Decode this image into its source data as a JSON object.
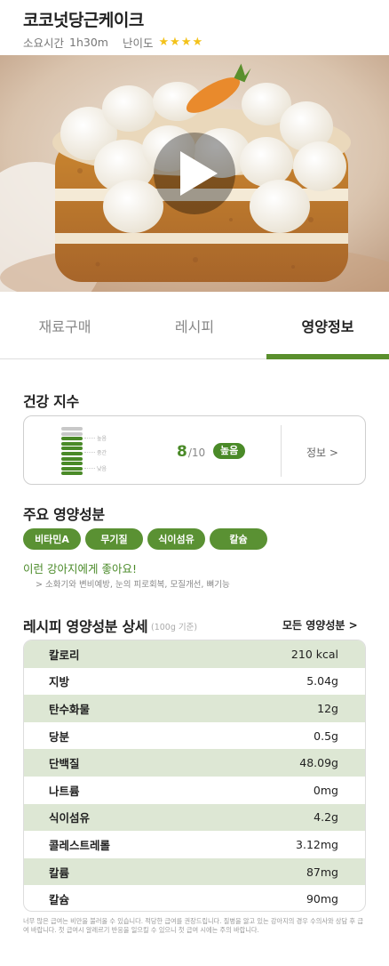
{
  "recipe": {
    "title": "코코넛당근케이크",
    "time_label": "소요시간",
    "time_value": "1h30m",
    "difficulty_label": "난이도",
    "difficulty_stars": 4,
    "star_color": "#f3c21a"
  },
  "video": {
    "play_icon": "play-icon"
  },
  "tabs": [
    {
      "label": "재료구매"
    },
    {
      "label": "레시피"
    },
    {
      "label": "영양정보"
    }
  ],
  "active_tab": 2,
  "accent_color": "#4a8a28",
  "health": {
    "title": "건강 지수",
    "gauge_levels": [
      "높음",
      "중간",
      "낮음"
    ],
    "score": "8",
    "score_max": "/10",
    "score_value": 0.8,
    "level": "높음",
    "info_link": "정보  >"
  },
  "main_nutrients": {
    "title": "주요 영양성분",
    "pills": [
      "비타민A",
      "무기질",
      "식이섬유",
      "칼슘"
    ],
    "good_for_title": "이런 강아지에게 좋아요!",
    "good_for_detail": ">   소화기와 변비예방, 눈의 피로회복, 모질개선, 뼈기능"
  },
  "detail": {
    "title": "레시피 영양성분 상세",
    "subtitle": "(100g 기준)",
    "all_link": "모든 영양성분 >",
    "rows": [
      {
        "name": "칼로리",
        "value": "210 kcal"
      },
      {
        "name": "지방",
        "value": "5.04g"
      },
      {
        "name": "탄수화물",
        "value": "12g"
      },
      {
        "name": "당분",
        "value": "0.5g"
      },
      {
        "name": "단백질",
        "value": "48.09g"
      },
      {
        "name": "나트륨",
        "value": "0mg"
      },
      {
        "name": "식이섬유",
        "value": "4.2g"
      },
      {
        "name": "콜레스트레롤",
        "value": "3.12mg"
      },
      {
        "name": "칼륨",
        "value": "87mg"
      },
      {
        "name": "칼슘",
        "value": "90mg"
      }
    ]
  },
  "disclaimer": "너무 많은 급여는 비만을 불러올 수 있습니다. 적당한 급여를 권장드립니다. 질병을 앓고 있는 강아지의 경우 수의사와 상담 후 급여 바랍니다. 첫 급여시 알레르기 반응을 일으킬 수 있으니 첫 급여 시에는 주의 바랍니다."
}
